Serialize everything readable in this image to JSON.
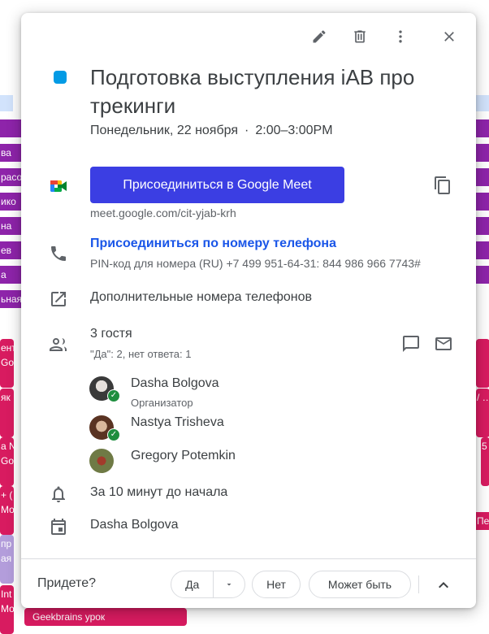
{
  "background": {
    "left_chips": [
      "",
      "ва",
      "расо",
      "ико",
      "на",
      "ев",
      "а",
      "ьная",
      "ент\nGo",
      "як",
      "а N\nGo",
      "+ (\nМо",
      "пр\nая",
      "Int\nМо"
    ],
    "right_chips": [
      "/ …",
      "Пер",
      "5"
    ],
    "bottom_chip": "Geekbrains урок"
  },
  "toolbar": {
    "edit_icon": "pencil-icon",
    "delete_icon": "trash-icon",
    "more_icon": "more-vert-icon",
    "close_icon": "close-icon"
  },
  "event": {
    "color": "#039be5",
    "title": "Подготовка выступления iAB про трекинги",
    "date": "Понедельник, 22 ноября",
    "separator": "·",
    "time": "2:00–3:00PM"
  },
  "meet": {
    "button_label": "Присоединиться в Google Meet",
    "url": "meet.google.com/cit-yjab-krh",
    "copy_icon": "copy-icon",
    "button_color": "#3b3ee3"
  },
  "phone": {
    "link_label": "Присоединиться по номеру телефона",
    "pin_text": "PIN-код для номера (RU) +7 499 951-64-31: 844 986 966 7743#",
    "more_label": "Дополнительные номера телефонов"
  },
  "guests": {
    "count_label": "3 гостя",
    "summary": "\"Да\": 2, нет ответа: 1",
    "list": [
      {
        "name": "Dasha Bolgova",
        "role": "Организатор",
        "accepted": true
      },
      {
        "name": "Nastya Trisheva",
        "role": "",
        "accepted": true
      },
      {
        "name": "Gregory Potemkin",
        "role": "",
        "accepted": false
      }
    ]
  },
  "reminder": "За 10 минут до начала",
  "calendar_owner": "Dasha Bolgova",
  "rsvp": {
    "question": "Придете?",
    "yes": "Да",
    "no": "Нет",
    "maybe": "Может быть"
  }
}
